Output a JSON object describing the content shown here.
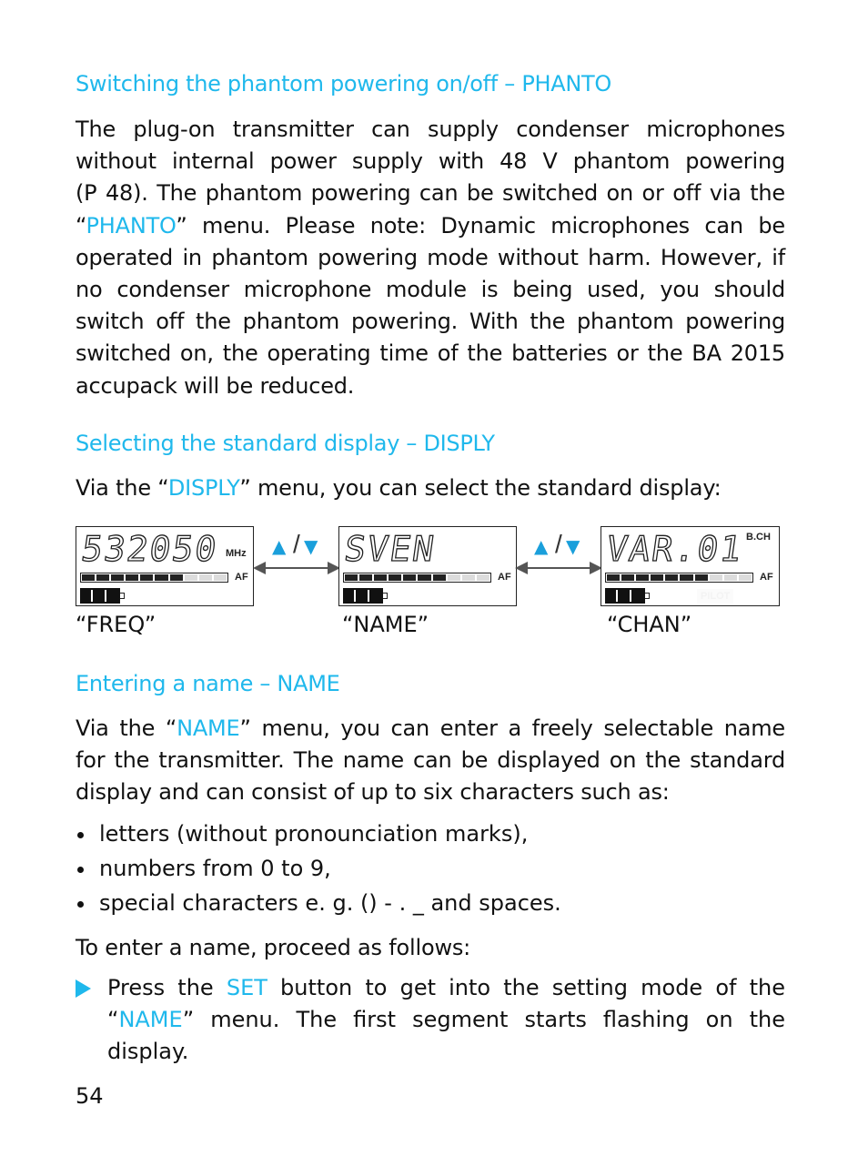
{
  "section1": {
    "heading": "Switching the phantom powering on/off – PHANTO",
    "lines": [
      [
        "The plug-on transmitter can supply condenser microphones"
      ],
      [
        "without internal power supply with 48 V phantom powering"
      ],
      [
        "(P 48). The phantom powering can be switched on or off via the"
      ],
      [
        "“",
        "PHANTO",
        "” menu. Please note: Dynamic microphones can be"
      ],
      [
        "operated in phantom powering mode without harm. However, if"
      ],
      [
        "no condenser microphone module is being used, you should"
      ],
      [
        "switch off the phantom powering. With the phantom powering"
      ],
      [
        "switched on, the operating time of the batteries or the BA 2015"
      ],
      [
        "accupack will be reduced."
      ]
    ]
  },
  "section2": {
    "heading": "Selecting the standard display – DISPLY",
    "intro_pre": "Via the “",
    "intro_hl": "DISPLY",
    "intro_post": "” menu, you can select the standard display:",
    "displays": [
      {
        "segment_text": "532050",
        "unit": "MHz",
        "af_label": "AF",
        "af_level_segments": 7,
        "af_total_segments": 10,
        "caption": "“FREQ”"
      },
      {
        "segment_text": "SVEN",
        "unit": "",
        "af_label": "AF",
        "af_level_segments": 7,
        "af_total_segments": 10,
        "caption": "“NAME”"
      },
      {
        "segment_text": "VAR.01",
        "unit": "B.CH",
        "af_label": "AF",
        "af_level_segments": 7,
        "af_total_segments": 10,
        "pilot_label": "PILOT",
        "caption": "“CHAN”"
      }
    ],
    "nav_symbol": {
      "up": "▲",
      "slash": "/",
      "down": "▼"
    }
  },
  "section3": {
    "heading": "Entering a name – NAME",
    "lines": [
      [
        "Via the “",
        "NAME",
        "” menu, you can enter a freely selectable name"
      ],
      [
        "for the transmitter. The name can be displayed on the standard"
      ],
      [
        "display and can consist of up to six characters such as:"
      ]
    ],
    "bullets": [
      "letters (without pronounciation marks),",
      "numbers from 0 to 9,",
      "special characters e. g. () - . _ and spaces."
    ],
    "proceed": "To enter a name, proceed as follows:",
    "step_lines": [
      [
        "Press the ",
        "SET",
        " button to get into the setting mode of the"
      ],
      [
        "“",
        "NAME",
        "” menu. The first segment starts flashing on the"
      ],
      [
        "display."
      ]
    ]
  },
  "page_number": "54",
  "colors": {
    "accent": "#1fb8ec",
    "text": "#111111"
  }
}
